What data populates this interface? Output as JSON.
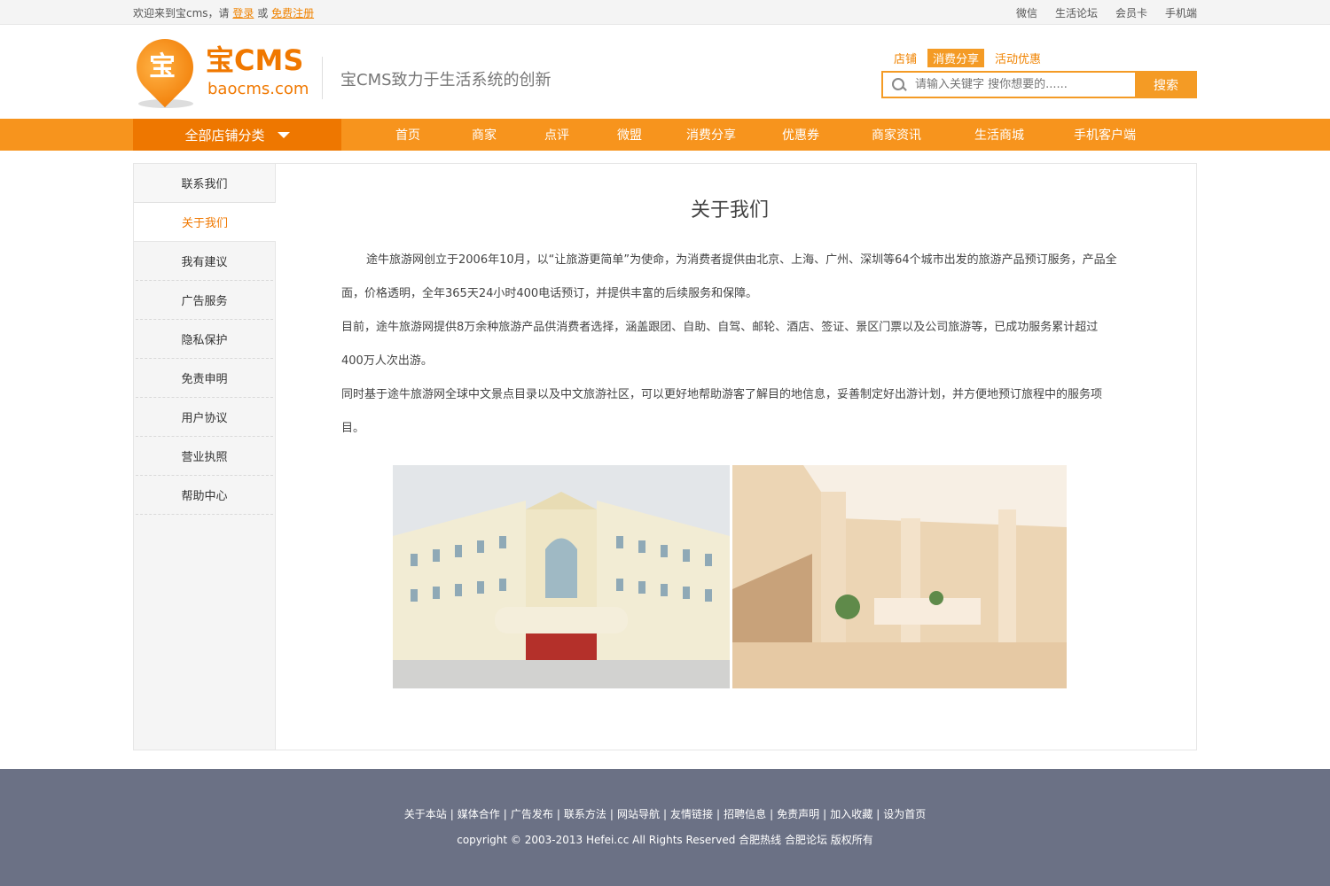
{
  "topbar": {
    "welcome_prefix": "欢迎来到宝cms，请",
    "login": "登录",
    "or": "或",
    "register": "免费注册",
    "links": [
      "微信",
      "生活论坛",
      "会员卡",
      "手机端"
    ]
  },
  "header": {
    "logo_char": "宝",
    "brand": "宝CMS",
    "domain": "baocms.com",
    "slogan": "宝CMS致力于生活系统的创新"
  },
  "search": {
    "tabs": [
      "店铺",
      "消费分享",
      "活动优惠"
    ],
    "active_tab": "消费分享",
    "placeholder": "请输入关键字 搜你想要的......",
    "button": "搜索"
  },
  "nav": {
    "category": "全部店铺分类",
    "items": [
      "首页",
      "商家",
      "点评",
      "微盟",
      "消费分享",
      "优惠券",
      "商家资讯",
      "生活商城",
      "手机客户端"
    ]
  },
  "sidebar": {
    "items": [
      "联系我们",
      "关于我们",
      "我有建议",
      "广告服务",
      "隐私保护",
      "免责申明",
      "用户协议",
      "营业执照",
      "帮助中心"
    ],
    "active": "关于我们"
  },
  "main": {
    "title": "关于我们",
    "paragraphs": [
      "途牛旅游网创立于2006年10月，以“让旅游更简单”为使命，为消费者提供由北京、上海、广州、深圳等64个城市出发的旅游产品预订服务，产品全面，价格透明，全年365天24小时400电话预订，并提供丰富的后续服务和保障。",
      "目前，途牛旅游网提供8万余种旅游产品供消费者选择，涵盖跟团、自助、自驾、邮轮、酒店、签证、景区门票以及公司旅游等，已成功服务累计超过400万人次出游。",
      "同时基于途牛旅游网全球中文景点目录以及中文旅游社区，可以更好地帮助游客了解目的地信息，妥善制定好出游计划，并方便地预订旅程中的服务项目。"
    ]
  },
  "footer": {
    "links": [
      "关于本站",
      "媒体合作",
      "广告发布",
      "联系方法",
      "网站导航",
      "友情链接",
      "招聘信息",
      "免责声明",
      "加入收藏",
      "设为首页"
    ],
    "copyright": "copyright © 2003-2013 Hefei.cc All Rights Reserved 合肥热线 合肥论坛 版权所有"
  }
}
